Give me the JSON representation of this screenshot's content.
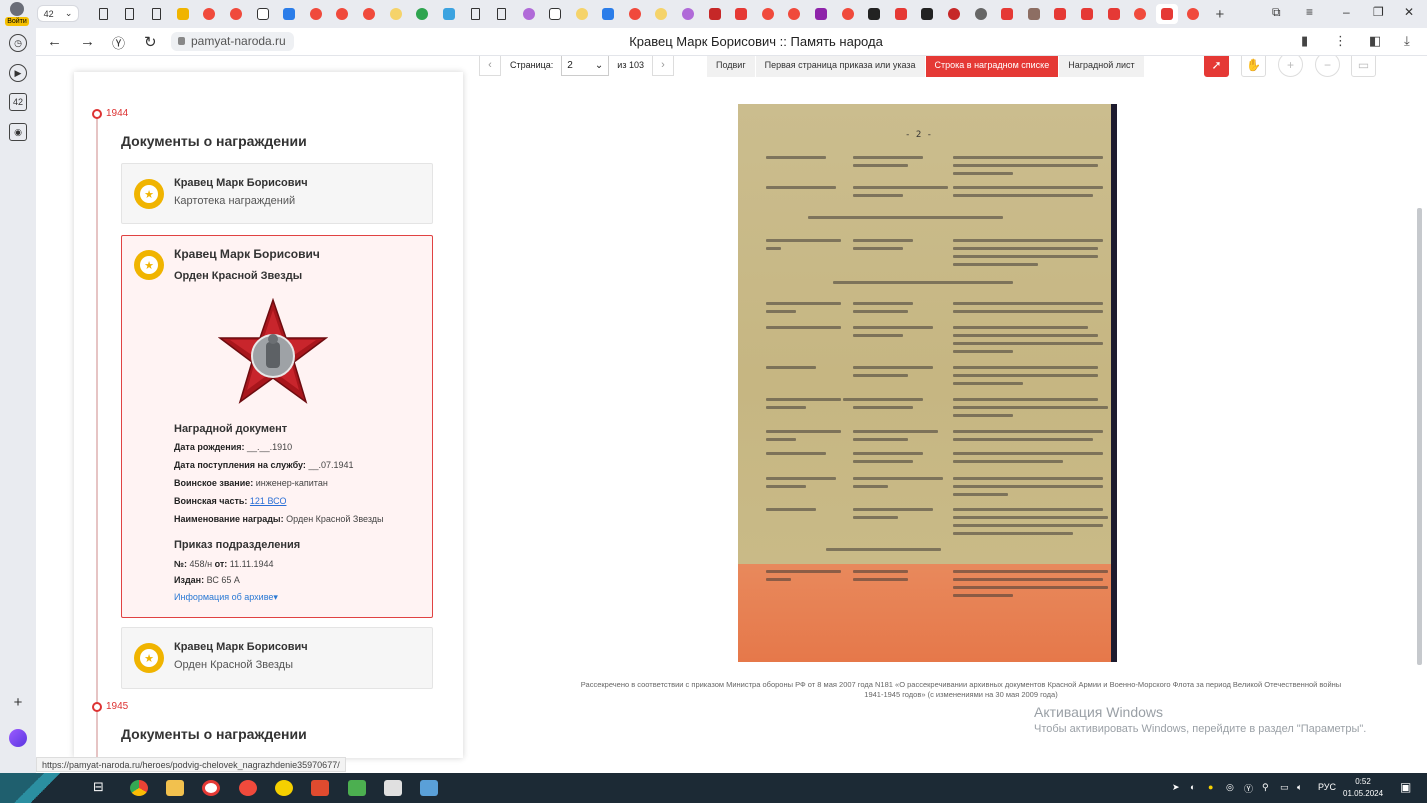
{
  "browser": {
    "tab_count": "42",
    "profile_label": "Войти",
    "url_domain": "pamyat-naroda.ru",
    "page_title": "Кравец Марк Борисович :: Память народа",
    "sidebar_badge": "42",
    "status_url": "https://pamyat-naroda.ru/heroes/podvig-chelovek_nagrazhdenie35970677/"
  },
  "timeline": {
    "year1": "1944",
    "section1_title": "Документы о награждении",
    "card1": {
      "name": "Кравец Марк Борисович",
      "sub": "Картотека награждений"
    },
    "card2": {
      "name": "Кравец Марк Борисович",
      "sub": "Орден Красной Звезды",
      "award_doc_heading": "Наградной документ",
      "birth_label": "Дата рождения:",
      "birth_value": "__.__.1910",
      "service_label": "Дата поступления на службу:",
      "service_value": "__.07.1941",
      "rank_label": "Воинское звание:",
      "rank_value": "инженер-капитан",
      "unit_label": "Воинская часть:",
      "unit_value": "121 ВСО",
      "award_label": "Наименование награды:",
      "award_value": "Орден Красной Звезды",
      "order_heading": "Приказ подразделения",
      "order_no_label": "№:",
      "order_no_value": "458/н",
      "order_from_label": "от:",
      "order_from_value": "11.11.1944",
      "issued_label": "Издан:",
      "issued_value": "ВС 65 А",
      "archive_link": "Информация об архиве"
    },
    "card3": {
      "name": "Кравец Марк Борисович",
      "sub": "Орден Красной Звезды"
    },
    "year2": "1945",
    "section2_title": "Документы о награждении"
  },
  "viewer": {
    "page_label": "Страница:",
    "page_value": "2",
    "page_total": "из 103",
    "tabs": [
      "Подвиг",
      "Первая страница приказа или указа",
      "Строка в наградном списке",
      "Наградной лист"
    ],
    "active_tab": "Строка в наградном списке",
    "scan_page_number": "- 2 -",
    "caption_line1": "Рассекречено в соответствии с приказом Министра обороны РФ от 8 мая 2007 года N181 «О рассекречивании архивных документов Красной Армии и Военно-Морского Флота за период Великой Отечественной войны",
    "caption_line2": "1941-1945 годов» (с изменениями на 30 мая 2009 года)"
  },
  "windows": {
    "activation_title": "Активация Windows",
    "activation_sub": "Чтобы активировать Windows, перейдите в раздел \"Параметры\".",
    "lang": "РУС",
    "time": "0:52",
    "date": "01.05.2024"
  },
  "colors": {
    "accent_red": "#e53935",
    "medal_gold": "#f0b400",
    "link_blue": "#2a6fd6"
  }
}
